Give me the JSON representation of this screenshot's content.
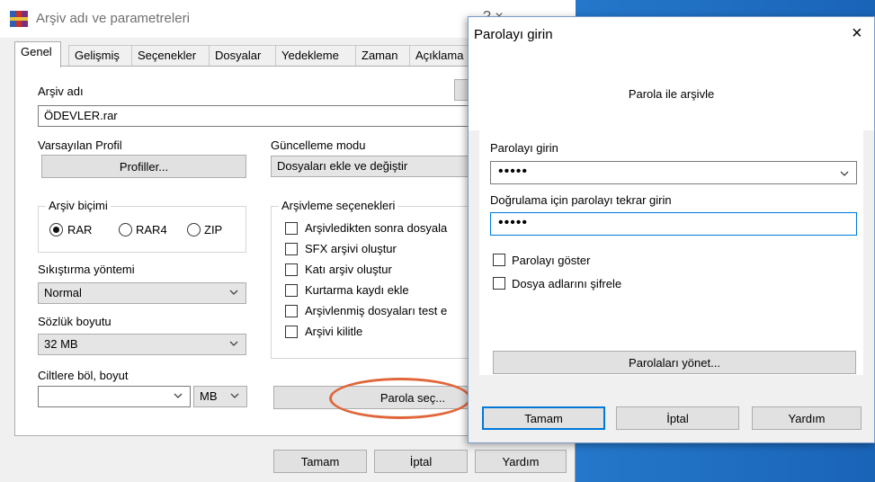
{
  "main_window": {
    "title": "Arşiv adı ve parametreleri",
    "tabs": [
      "Genel",
      "Gelişmiş",
      "Seçenekler",
      "Dosyalar",
      "Yedekleme",
      "Zaman",
      "Açıklama"
    ],
    "archive_name_label": "Arşiv adı",
    "archive_name_value": "ÖDEVLER.rar",
    "profile_label": "Varsayılan Profil",
    "profiles_button": "Profiller...",
    "update_mode_label": "Güncelleme modu",
    "update_mode_value": "Dosyaları ekle ve değiştir",
    "archive_format_group": "Arşiv biçimi",
    "format_rar": "RAR",
    "format_rar4": "RAR4",
    "format_zip": "ZIP",
    "compression_label": "Sıkıştırma yöntemi",
    "compression_value": "Normal",
    "dictionary_label": "Sözlük boyutu",
    "dictionary_value": "32 MB",
    "split_label": "Ciltlere böl, boyut",
    "split_unit": "MB",
    "options_group": "Arşivleme seçenekleri",
    "options": [
      "Arşivledikten sonra dosyala",
      "SFX arşivi oluştur",
      "Katı arşiv oluştur",
      "Kurtarma kaydı ekle",
      "Arşivlenmiş dosyaları test e",
      "Arşivi kilitle"
    ],
    "set_password_button": "Parola seç...",
    "ok_button": "Tamam",
    "cancel_button": "İptal",
    "help_button": "Yardım",
    "title_glyphs": "? ×"
  },
  "password_dialog": {
    "title": "Parolayı girin",
    "subtitle": "Parola ile arşivle",
    "enter_label": "Parolayı girin",
    "enter_value": "•••••",
    "confirm_label": "Doğrulama için parolayı tekrar girin",
    "confirm_value": "•••••",
    "show_password": "Parolayı göster",
    "encrypt_names": "Dosya adlarını şifrele",
    "manage_button": "Parolaları yönet...",
    "ok_button": "Tamam",
    "cancel_button": "İptal",
    "help_button": "Yardım",
    "close_glyph": "×"
  },
  "colors": {
    "highlight": "#e0663a",
    "focus": "#0078d7",
    "desktop": "#2c86d8"
  },
  "icons": [
    "winrar-app-icon",
    "close-icon",
    "chevron-down-icon"
  ]
}
